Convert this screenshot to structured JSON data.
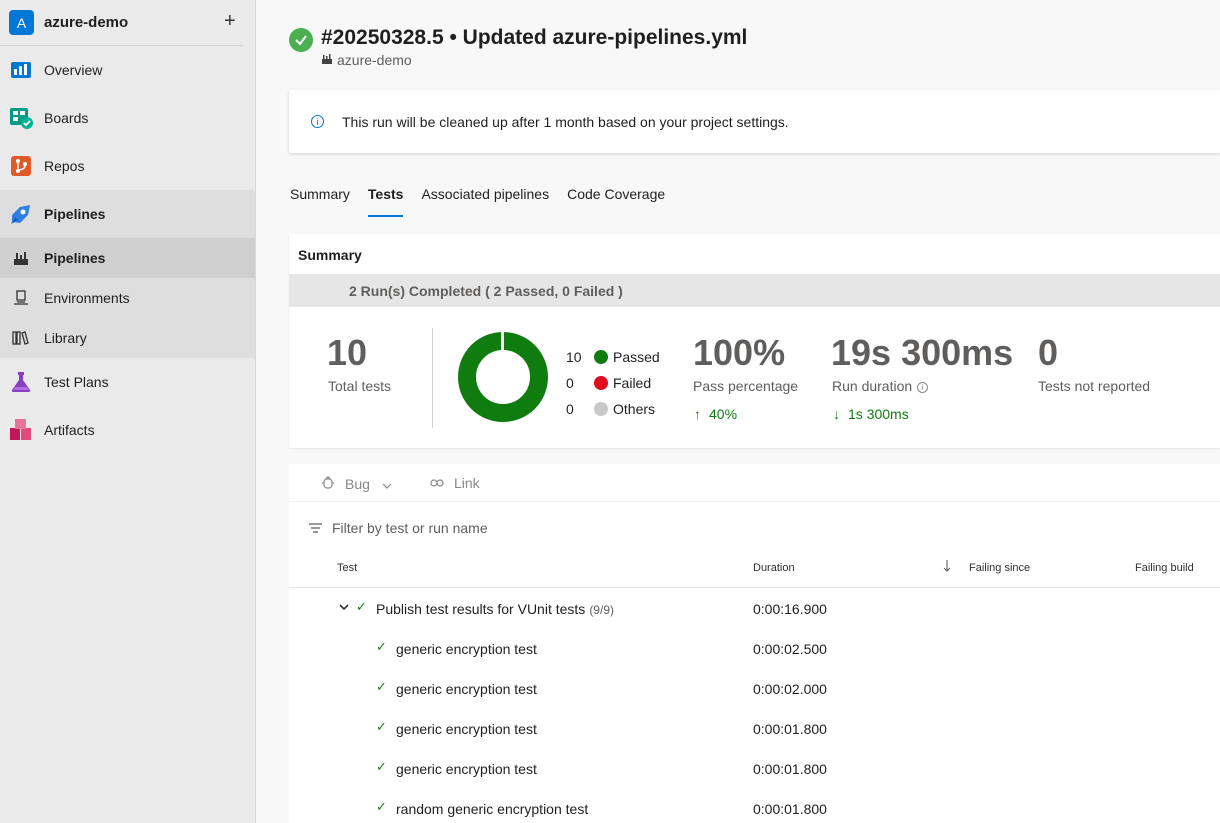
{
  "org": {
    "initial": "A",
    "name": "azure-demo",
    "add_label": "+"
  },
  "nav": [
    {
      "label": "Overview",
      "icon": "overview-icon"
    },
    {
      "label": "Boards",
      "icon": "boards-icon"
    },
    {
      "label": "Repos",
      "icon": "repos-icon"
    },
    {
      "label": "Pipelines",
      "icon": "pipelines-icon"
    }
  ],
  "subnav": [
    {
      "label": "Pipelines",
      "icon": "pipelines-sub-icon"
    },
    {
      "label": "Environments",
      "icon": "environments-icon"
    },
    {
      "label": "Library",
      "icon": "library-icon"
    }
  ],
  "nav_bottom": [
    {
      "label": "Test Plans",
      "icon": "test-plans-icon"
    },
    {
      "label": "Artifacts",
      "icon": "artifacts-icon"
    }
  ],
  "run": {
    "title": "#20250328.5 • Updated azure-pipelines.yml",
    "project": "azure-demo"
  },
  "banner": {
    "text": "This run will be cleaned up after 1 month based on your project settings."
  },
  "tabs": [
    "Summary",
    "Tests",
    "Associated pipelines",
    "Code Coverage"
  ],
  "summary": {
    "title": "Summary",
    "runs_completed": "2 Run(s) Completed ( 2 Passed, 0 Failed )",
    "total_tests": "10",
    "total_tests_label": "Total tests",
    "legend": [
      {
        "count": "10",
        "label": "Passed",
        "color": "#107c10"
      },
      {
        "count": "0",
        "label": "Failed",
        "color": "#e00b1c"
      },
      {
        "count": "0",
        "label": "Others",
        "color": "#c8c8c8"
      }
    ],
    "pass_pct": "100%",
    "pass_pct_label": "Pass percentage",
    "pass_trend": "40%",
    "duration": "19s 300ms",
    "duration_label": "Run duration",
    "duration_trend": "1s 300ms",
    "not_reported": "0",
    "not_reported_label": "Tests not reported"
  },
  "toolbar": {
    "bug_label": "Bug",
    "link_label": "Link"
  },
  "filter": {
    "placeholder": "Filter by test or run name"
  },
  "columns": {
    "test": "Test",
    "duration": "Duration",
    "failing_since": "Failing since",
    "failing_build": "Failing build"
  },
  "group": {
    "name": "Publish test results for VUnit tests",
    "count": "(9/9)",
    "duration": "0:00:16.900"
  },
  "tests": [
    {
      "name": "generic encryption test",
      "duration": "0:00:02.500"
    },
    {
      "name": "generic encryption test",
      "duration": "0:00:02.000"
    },
    {
      "name": "generic encryption test",
      "duration": "0:00:01.800"
    },
    {
      "name": "generic encryption test",
      "duration": "0:00:01.800"
    },
    {
      "name": "random generic encryption test",
      "duration": "0:00:01.800"
    }
  ],
  "colors": {
    "accent": "#0078d4",
    "success": "#107c10"
  }
}
